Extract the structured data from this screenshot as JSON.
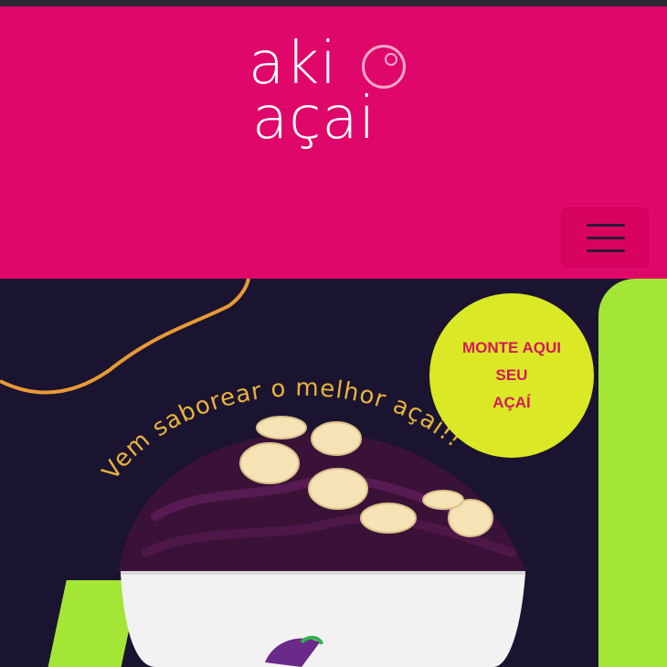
{
  "brand": {
    "line1": "aki",
    "line2": "açai"
  },
  "menu": {
    "icon": "hamburger-icon"
  },
  "cta": {
    "line1": "MONTE AQUI",
    "line2": "SEU",
    "line3": "AÇAÍ"
  },
  "hero": {
    "tagline": "Vem saborear o melhor açaí!!"
  },
  "colors": {
    "header": "#e0076a",
    "hero_bg": "#1b1430",
    "lime": "#a3e635",
    "cta_bg": "#dbe825",
    "cta_text": "#d6175a",
    "tagline": "#e8b33c"
  }
}
